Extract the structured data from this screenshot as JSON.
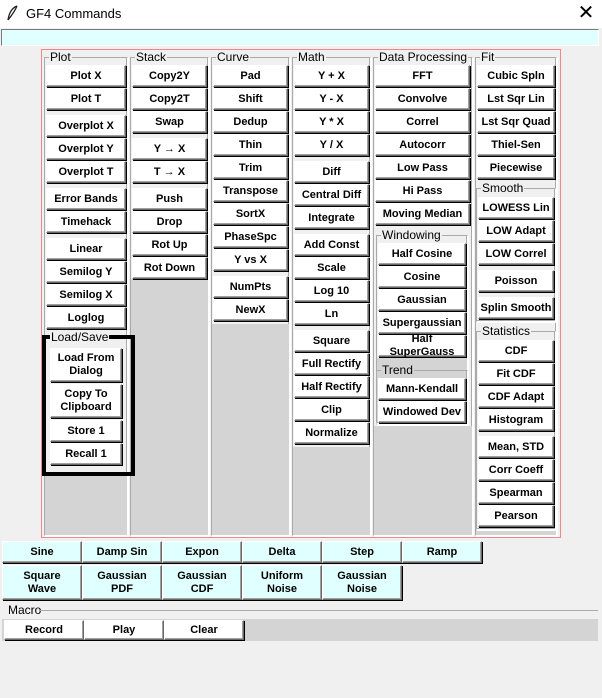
{
  "window": {
    "title": "GF4 Commands",
    "close_symbol": "✕"
  },
  "groups": {
    "plot": "Plot",
    "stack": "Stack",
    "curve": "Curve",
    "math": "Math",
    "data_processing": "Data Processing",
    "fit": "Fit",
    "load_save": "Load/Save",
    "windowing": "Windowing",
    "trend": "Trend",
    "smooth": "Smooth",
    "statistics": "Statistics",
    "macro": "Macro"
  },
  "plot": [
    "Plot X",
    "Plot T",
    "Overplot X",
    "Overplot Y",
    "Overplot T",
    "Error Bands",
    "Timehack",
    "Linear",
    "Semilog Y",
    "Semilog X",
    "Loglog"
  ],
  "load_save": [
    "Load From\nDialog",
    "Copy To\nClipboard",
    "Store 1",
    "Recall 1"
  ],
  "stack": [
    "Copy2Y",
    "Copy2T",
    "Swap",
    "Y → X",
    "T → X",
    "Push",
    "Drop",
    "Rot Up",
    "Rot Down"
  ],
  "curve": [
    "Pad",
    "Shift",
    "Dedup",
    "Thin",
    "Trim",
    "Transpose",
    "SortX",
    "PhaseSpc",
    "Y vs X",
    "NumPts",
    "NewX"
  ],
  "math": [
    "Y + X",
    "Y - X",
    "Y * X",
    "Y / X",
    "Diff",
    "Central Diff",
    "Integrate",
    "Add Const",
    "Scale",
    "Log 10",
    "Ln",
    "Square",
    "Full Rectify",
    "Half Rectify",
    "Clip",
    "Normalize"
  ],
  "data_processing": [
    "FFT",
    "Convolve",
    "Correl",
    "Autocorr",
    "Low Pass",
    "Hi Pass",
    "Moving Median"
  ],
  "windowing": [
    "Half Cosine",
    "Cosine",
    "Gaussian",
    "Supergaussian",
    "Half SuperGauss"
  ],
  "trend": [
    "Mann-Kendall",
    "Windowed Dev"
  ],
  "fit": [
    "Cubic Spln",
    "Lst Sqr Lin",
    "Lst Sqr Quad",
    "Thiel-Sen",
    "Piecewise"
  ],
  "smooth": [
    "LOWESS Lin",
    "LOW Adapt",
    "LOW Correl",
    "Poisson",
    "Splin Smooth"
  ],
  "statistics": [
    "CDF",
    "Fit CDF",
    "CDF Adapt",
    "Histogram",
    "Mean, STD",
    "Corr Coeff",
    "Spearman",
    "Pearson"
  ],
  "generators_row1": [
    "Sine",
    "Damp Sin",
    "Expon",
    "Delta",
    "Step",
    "Ramp"
  ],
  "generators_row2": [
    "Square\nWave",
    "Gaussian\nPDF",
    "Gaussian\nCDF",
    "Uniform\nNoise",
    "Gaussian\nNoise"
  ],
  "macro": [
    "Record",
    "Play",
    "Clear"
  ],
  "colors": {
    "accent_cyan": "#e0ffff",
    "panel_gray": "#d4d4d4",
    "border_red": "#e88"
  }
}
